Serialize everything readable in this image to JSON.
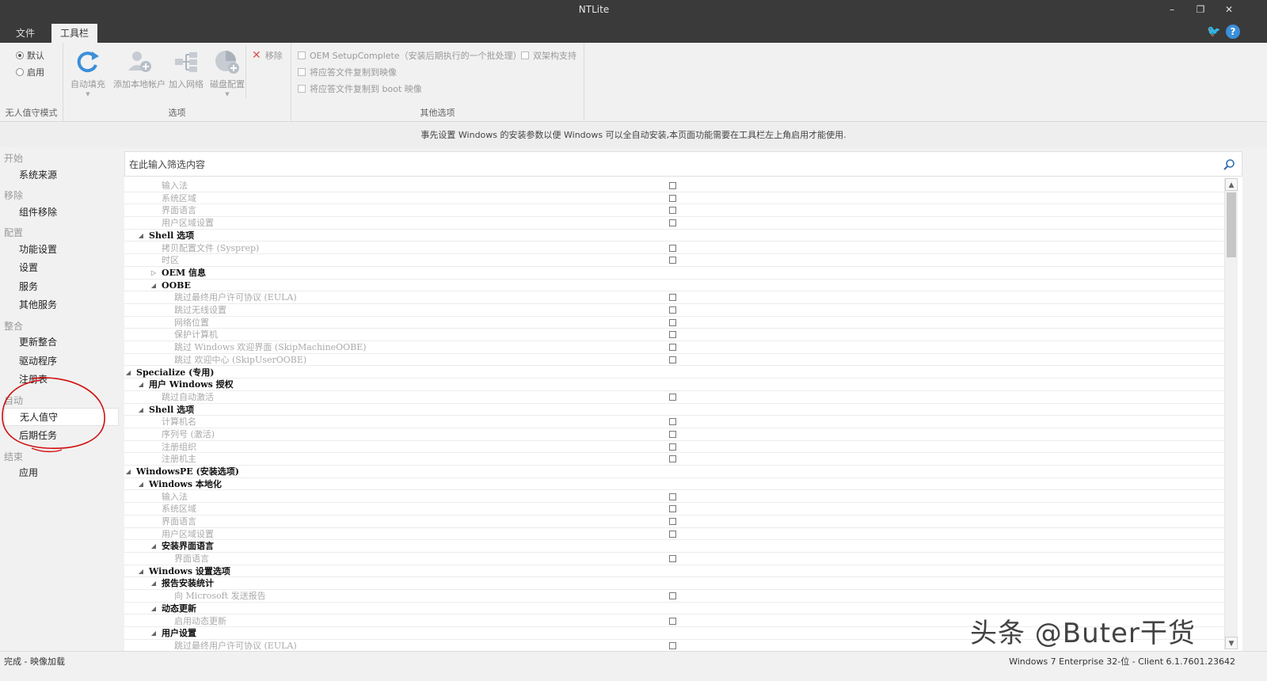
{
  "app": {
    "title": "NTLite"
  },
  "menu": {
    "tabs": [
      "文件",
      "工具栏"
    ]
  },
  "ribbon": {
    "mode_group": {
      "label": "无人值守模式",
      "options": [
        "默认",
        "启用"
      ],
      "selected": "默认"
    },
    "options_group": {
      "label": "选项",
      "buttons": [
        "自动填充",
        "添加本地帐户",
        "加入网络",
        "磁盘配置"
      ]
    },
    "remove_label": "移除",
    "other_group": {
      "label": "其他选项",
      "checks": [
        "OEM SetupComplete（安装后期执行的一个批处理）",
        "双架构支持",
        "将应答文件复制到映像",
        "将应答文件复制到 boot 映像"
      ]
    }
  },
  "description": "事先设置 Windows 的安装参数以便 Windows 可以全自动安装,本页面功能需要在工具栏左上角启用才能使用.",
  "sidebar": {
    "sections": [
      {
        "title": "开始",
        "items": [
          "系统来源"
        ]
      },
      {
        "title": "移除",
        "items": [
          "组件移除"
        ]
      },
      {
        "title": "配置",
        "items": [
          "功能设置",
          "设置",
          "服务",
          "其他服务"
        ]
      },
      {
        "title": "整合",
        "items": [
          "更新整合",
          "驱动程序",
          "注册表"
        ]
      },
      {
        "title": "自动",
        "items": [
          "无人值守",
          "后期任务"
        ]
      },
      {
        "title": "结束",
        "items": [
          "应用"
        ]
      }
    ],
    "active": "无人值守"
  },
  "filter": {
    "placeholder": "在此输入筛选内容"
  },
  "tree": [
    {
      "label": "输入法",
      "level": 2,
      "type": "item"
    },
    {
      "label": "系统区域",
      "level": 2,
      "type": "item"
    },
    {
      "label": "界面语言",
      "level": 2,
      "type": "item"
    },
    {
      "label": "用户区域设置",
      "level": 2,
      "type": "item"
    },
    {
      "label": "Shell 选项",
      "level": 1,
      "type": "group",
      "expanded": true
    },
    {
      "label": "拷贝配置文件 (Sysprep)",
      "level": 2,
      "type": "item"
    },
    {
      "label": "时区",
      "level": 2,
      "type": "item"
    },
    {
      "label": "OEM 信息",
      "level": 2,
      "type": "group",
      "expanded": false
    },
    {
      "label": "OOBE",
      "level": 2,
      "type": "group",
      "expanded": true
    },
    {
      "label": "跳过最终用户许可协议 (EULA)",
      "level": 3,
      "type": "item"
    },
    {
      "label": "跳过无线设置",
      "level": 3,
      "type": "item"
    },
    {
      "label": "网络位置",
      "level": 3,
      "type": "item"
    },
    {
      "label": "保护计算机",
      "level": 3,
      "type": "item"
    },
    {
      "label": "跳过 Windows 欢迎界面 (SkipMachineOOBE)",
      "level": 3,
      "type": "item"
    },
    {
      "label": "跳过 欢迎中心 (SkipUserOOBE)",
      "level": 3,
      "type": "item"
    },
    {
      "label": "Specialize (专用)",
      "level": 0,
      "type": "group",
      "expanded": true
    },
    {
      "label": "用户 Windows 授权",
      "level": 1,
      "type": "group",
      "expanded": true
    },
    {
      "label": "跳过自动激活",
      "level": 2,
      "type": "item"
    },
    {
      "label": "Shell 选项",
      "level": 1,
      "type": "group",
      "expanded": true
    },
    {
      "label": "计算机名",
      "level": 2,
      "type": "item"
    },
    {
      "label": "序列号 (激活)",
      "level": 2,
      "type": "item"
    },
    {
      "label": "注册组织",
      "level": 2,
      "type": "item"
    },
    {
      "label": "注册机主",
      "level": 2,
      "type": "item"
    },
    {
      "label": "WindowsPE (安装选项)",
      "level": 0,
      "type": "group",
      "expanded": true
    },
    {
      "label": "Windows 本地化",
      "level": 1,
      "type": "group",
      "expanded": true
    },
    {
      "label": "输入法",
      "level": 2,
      "type": "item"
    },
    {
      "label": "系统区域",
      "level": 2,
      "type": "item"
    },
    {
      "label": "界面语言",
      "level": 2,
      "type": "item"
    },
    {
      "label": "用户区域设置",
      "level": 2,
      "type": "item"
    },
    {
      "label": "安装界面语言",
      "level": 2,
      "type": "group",
      "expanded": true
    },
    {
      "label": "界面语言",
      "level": 3,
      "type": "item"
    },
    {
      "label": "Windows 设置选项",
      "level": 1,
      "type": "group",
      "expanded": true
    },
    {
      "label": "报告安装统计",
      "level": 2,
      "type": "group",
      "expanded": true
    },
    {
      "label": "向 Microsoft 发送报告",
      "level": 3,
      "type": "item"
    },
    {
      "label": "动态更新",
      "level": 2,
      "type": "group",
      "expanded": true
    },
    {
      "label": "启用动态更新",
      "level": 3,
      "type": "item"
    },
    {
      "label": "用户设置",
      "level": 2,
      "type": "group",
      "expanded": true
    },
    {
      "label": "跳过最终用户许可协议 (EULA)",
      "level": 3,
      "type": "item"
    }
  ],
  "status": {
    "left": "完成 - 映像加载",
    "right": "Windows 7 Enterprise 32-位 - Client 6.1.7601.23642"
  },
  "watermark": "头条 @Buter干货",
  "colors": {
    "titlebar": "#3a3a3a",
    "accent_blue": "#3b8fd9",
    "annotation": "#d01010"
  }
}
